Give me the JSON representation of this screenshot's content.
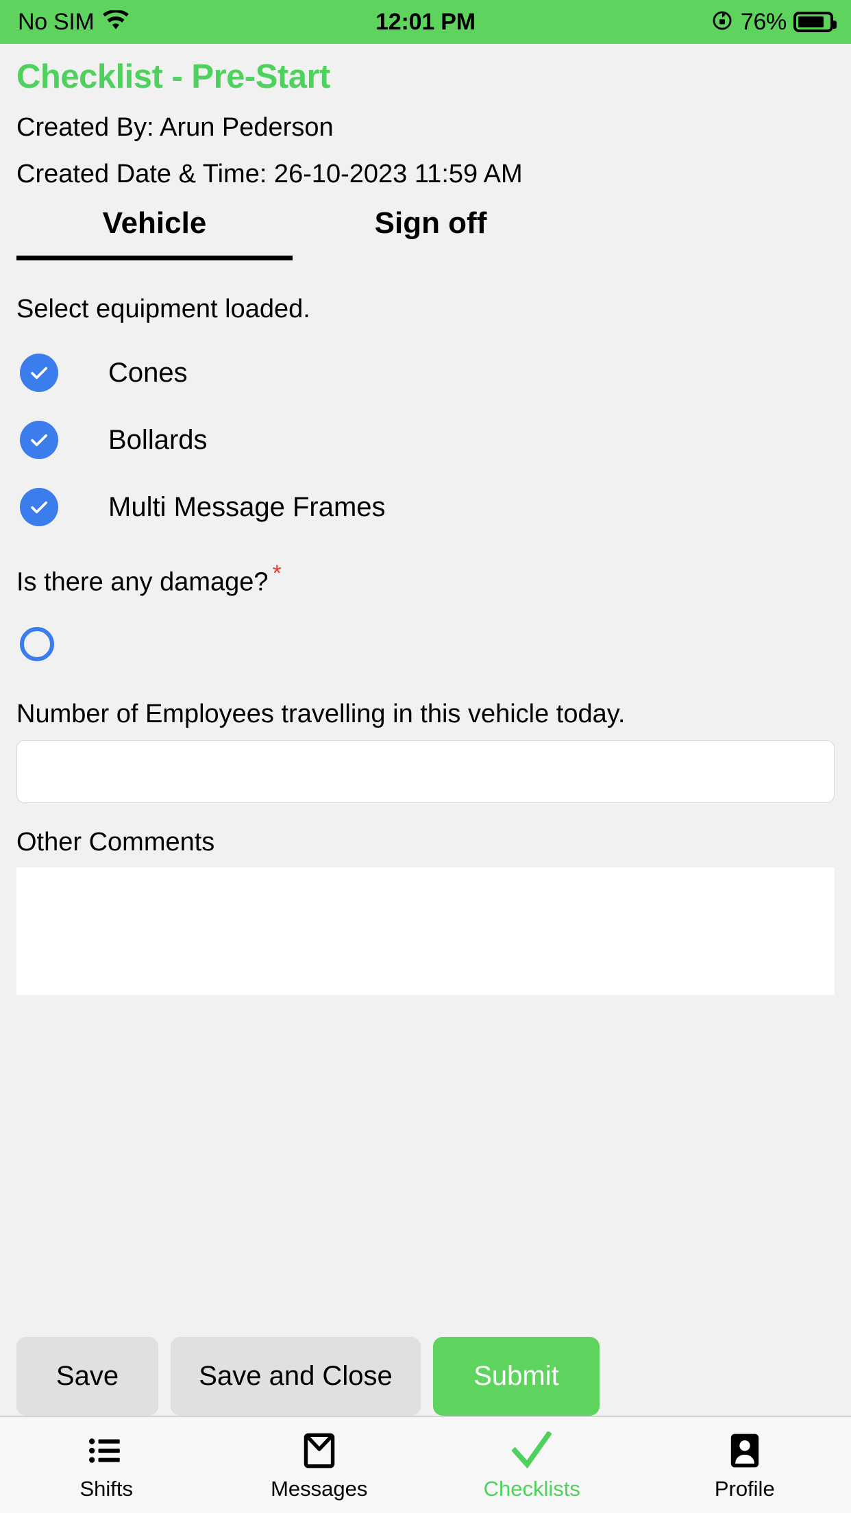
{
  "status_bar": {
    "carrier": "No SIM",
    "wifi_icon": "wifi-icon",
    "time": "12:01 PM",
    "rotation_lock_icon": "rotation-lock-icon",
    "battery_percent": "76%",
    "battery_icon": "battery-icon",
    "background_color": "#5ed45e"
  },
  "header": {
    "title": "Checklist - Pre-Start",
    "title_color": "#4fd15e",
    "created_by": "Created By: Arun Pederson",
    "created_datetime": "Created Date & Time: 26-10-2023 11:59 AM"
  },
  "tabs": [
    {
      "label": "Vehicle",
      "active": true
    },
    {
      "label": "Sign off",
      "active": false
    }
  ],
  "form": {
    "equipment_prompt": "Select equipment loaded.",
    "equipment_options": [
      {
        "label": "Cones",
        "checked": true
      },
      {
        "label": "Bollards",
        "checked": true
      },
      {
        "label": "Multi Message Frames",
        "checked": true
      }
    ],
    "damage_question": "Is there any damage?",
    "damage_required_marker": "*",
    "damage_required_color": "#ea3b2b",
    "damage_option_checked": false,
    "employees_label": "Number of Employees travelling in this vehicle today.",
    "employees_value": "",
    "employees_placeholder": "",
    "comments_label": "Other Comments",
    "comments_value": "",
    "comments_placeholder": "",
    "checkbox_color": "#3b7ded"
  },
  "actions": {
    "save_label": "Save",
    "save_and_close_label": "Save and Close",
    "submit_label": "Submit",
    "submit_color": "#5ed45e"
  },
  "tabbar": [
    {
      "label": "Shifts",
      "icon": "list-icon",
      "active": false
    },
    {
      "label": "Messages",
      "icon": "envelope-icon",
      "active": false
    },
    {
      "label": "Checklists",
      "icon": "checkmark-icon",
      "active": true
    },
    {
      "label": "Profile",
      "icon": "person-icon",
      "active": false
    }
  ]
}
